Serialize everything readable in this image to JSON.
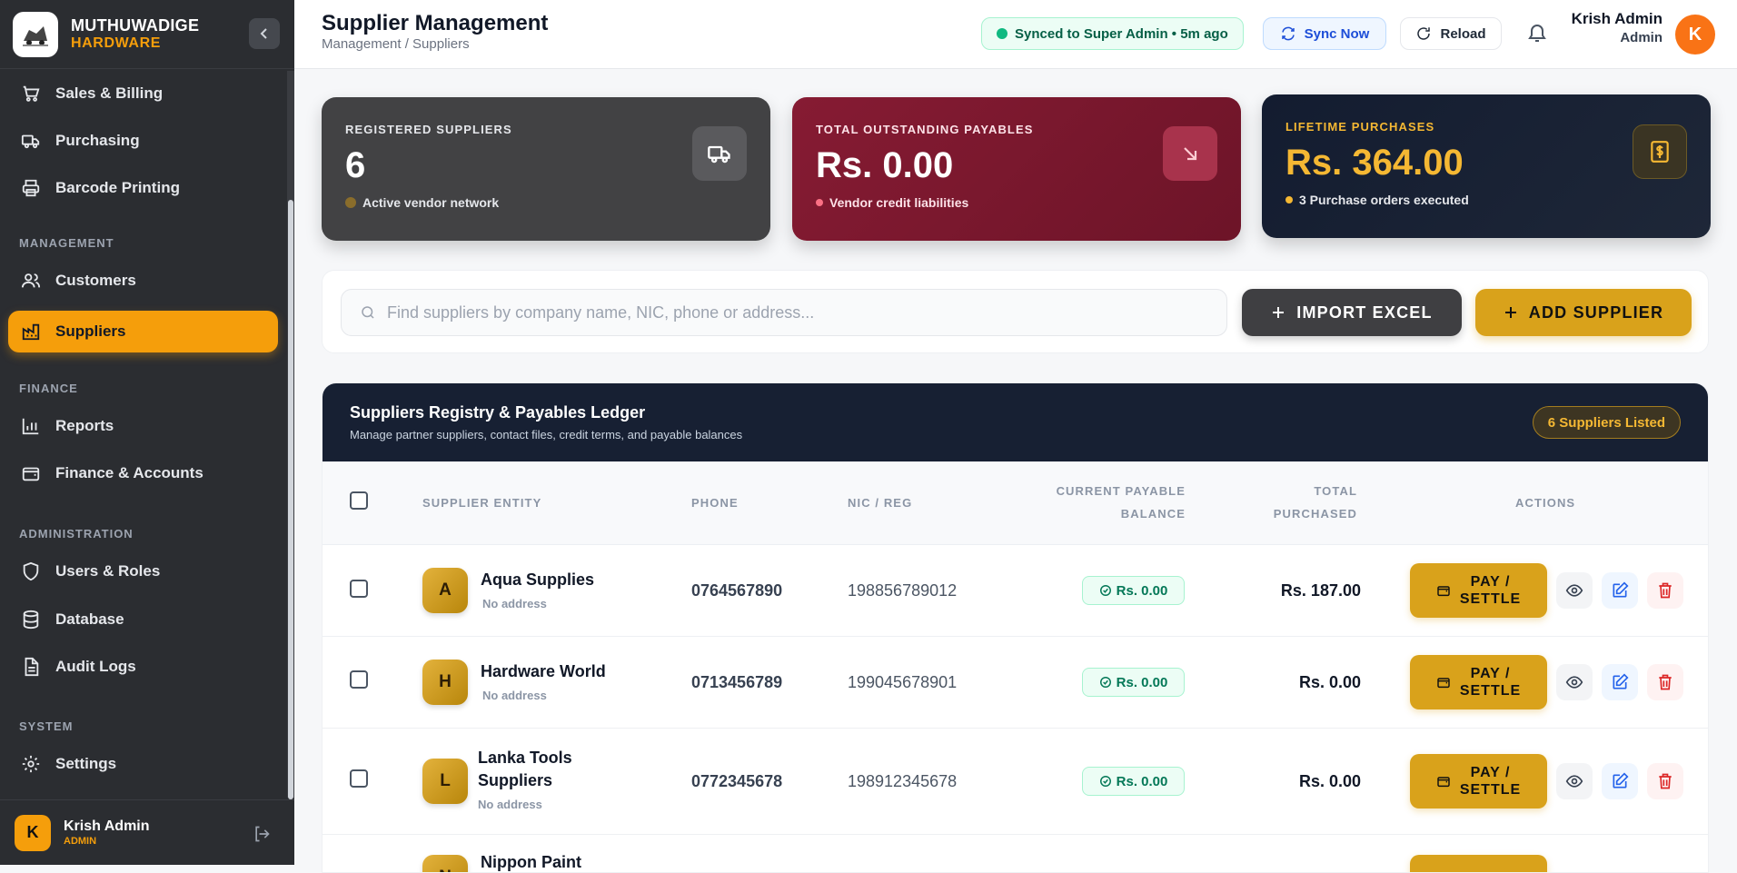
{
  "brand": {
    "name": "MUTHUWADIGE",
    "sub": "HARDWARE"
  },
  "sidebar": {
    "items": [
      {
        "label": "Sales & Billing",
        "icon": "cart-icon"
      },
      {
        "label": "Purchasing",
        "icon": "truck-icon"
      },
      {
        "label": "Barcode Printing",
        "icon": "printer-icon"
      },
      {
        "label": "Customers",
        "icon": "users-icon"
      },
      {
        "label": "Suppliers",
        "icon": "factory-icon",
        "active": true
      },
      {
        "label": "Reports",
        "icon": "bar-chart-icon"
      },
      {
        "label": "Finance & Accounts",
        "icon": "wallet-icon"
      },
      {
        "label": "Users & Roles",
        "icon": "shield-icon"
      },
      {
        "label": "Database",
        "icon": "database-icon"
      },
      {
        "label": "Audit Logs",
        "icon": "file-text-icon"
      },
      {
        "label": "Settings",
        "icon": "gear-icon"
      }
    ],
    "sections": {
      "management": "MANAGEMENT",
      "finance": "FINANCE",
      "administration": "ADMINISTRATION",
      "system": "SYSTEM"
    },
    "profile": {
      "initial": "K",
      "name": "Krish Admin",
      "role": "ADMIN"
    }
  },
  "header": {
    "title": "Supplier Management",
    "breadcrumb": "Management / Suppliers",
    "sync_status": "Synced to Super Admin • 5m ago",
    "sync_now": "Sync Now",
    "reload": "Reload",
    "user_name": "Krish Admin",
    "user_role": "Admin",
    "user_initial": "K"
  },
  "stats": [
    {
      "label": "REGISTERED SUPPLIERS",
      "value": "6",
      "sub": "Active vendor network"
    },
    {
      "label": "TOTAL OUTSTANDING PAYABLES",
      "value": "Rs. 0.00",
      "sub": "Vendor credit liabilities"
    },
    {
      "label": "LIFETIME PURCHASES",
      "value": "Rs. 364.00",
      "sub": "3 Purchase orders executed"
    }
  ],
  "search": {
    "placeholder": "Find suppliers by company name, NIC, phone or address..."
  },
  "actions": {
    "import": "IMPORT EXCEL",
    "add": "ADD SUPPLIER"
  },
  "table": {
    "title": "Suppliers Registry & Payables Ledger",
    "subtitle": "Manage partner suppliers, contact files, credit terms, and payable balances",
    "count_badge": "6 Suppliers Listed",
    "headers": {
      "entity": "SUPPLIER ENTITY",
      "phone": "PHONE",
      "nic": "NIC / REG",
      "balance_1": "CURRENT PAYABLE",
      "balance_2": "BALANCE",
      "total_1": "TOTAL",
      "total_2": "PURCHASED",
      "actions": "ACTIONS"
    },
    "pay_label_1": "PAY /",
    "pay_label_2": "SETTLE",
    "rows": [
      {
        "initial": "A",
        "name": "Aqua Supplies",
        "address": "No address",
        "phone": "0764567890",
        "nic": "198856789012",
        "balance": "Rs. 0.00",
        "total": "Rs. 187.00"
      },
      {
        "initial": "H",
        "name": "Hardware World",
        "address": "No address",
        "phone": "0713456789",
        "nic": "199045678901",
        "balance": "Rs. 0.00",
        "total": "Rs. 0.00"
      },
      {
        "initial": "L",
        "name_1": "Lanka Tools",
        "name_2": "Suppliers",
        "address": "No address",
        "phone": "0772345678",
        "nic": "198912345678",
        "balance": "Rs. 0.00",
        "total": "Rs. 0.00"
      },
      {
        "initial": "N",
        "name": "Nippon Paint"
      }
    ]
  }
}
